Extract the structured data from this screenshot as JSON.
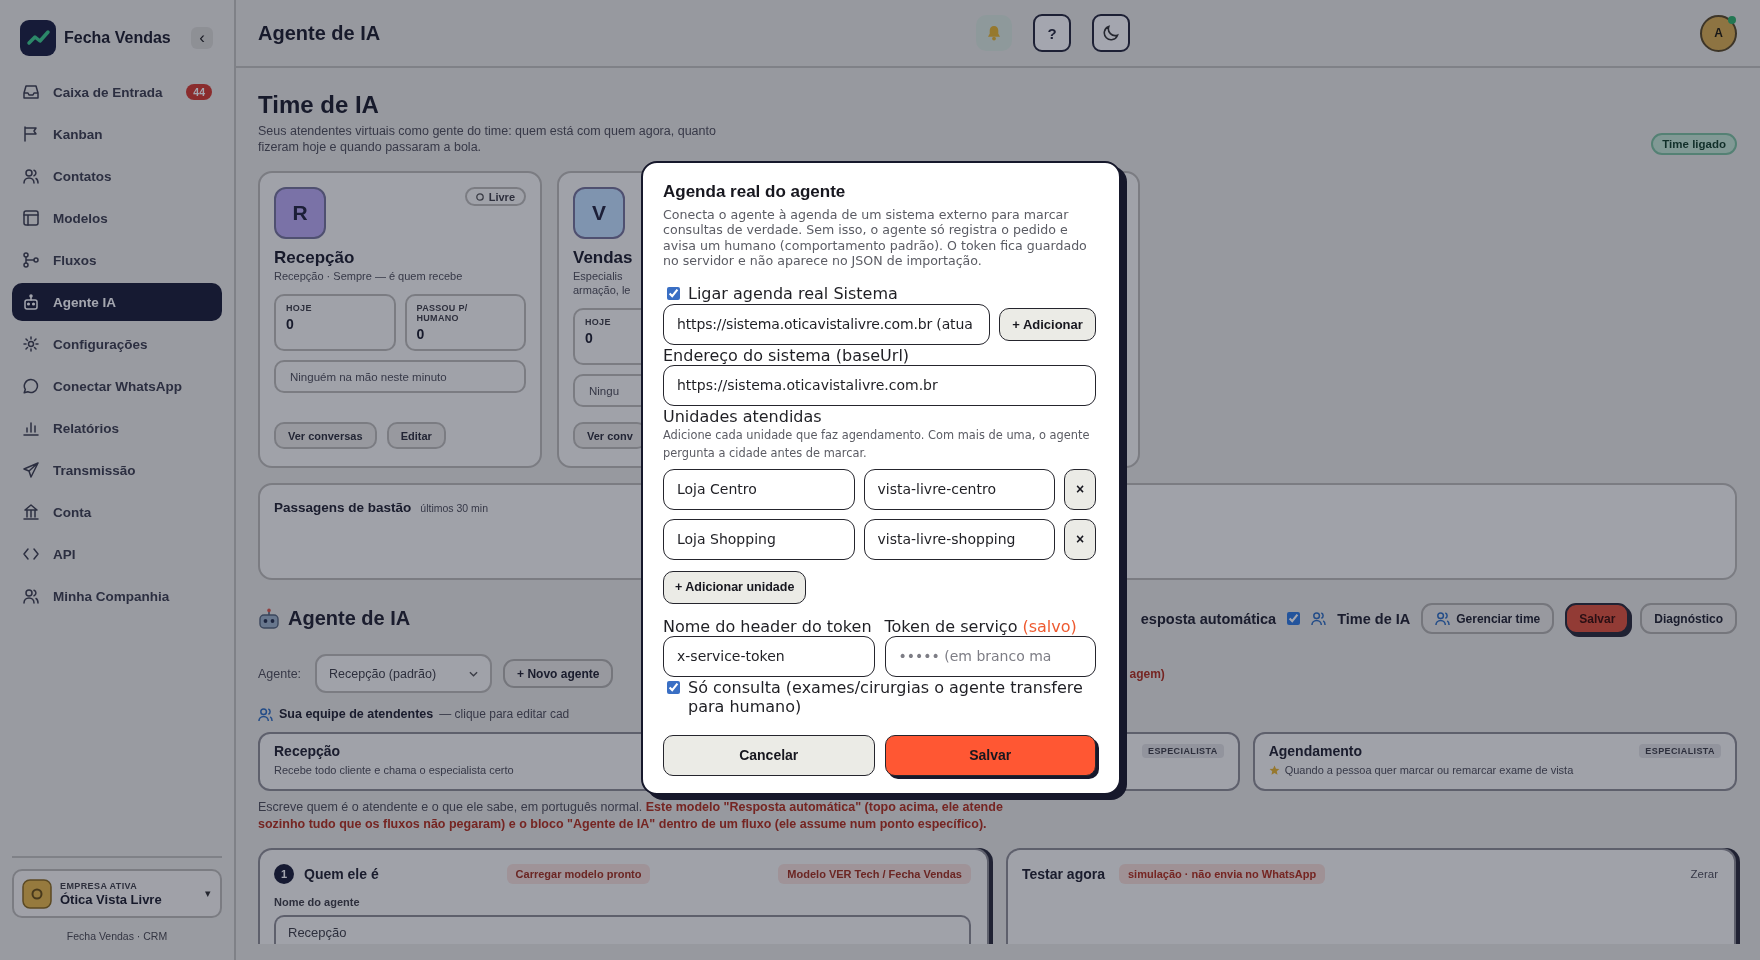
{
  "sidebar": {
    "brand": "Fecha Vendas",
    "collapse": "‹",
    "items": [
      {
        "label": "Caixa de Entrada",
        "selected": false,
        "badge": "44"
      },
      {
        "label": "Kanban",
        "selected": false
      },
      {
        "label": "Contatos",
        "selected": false
      },
      {
        "label": "Modelos",
        "selected": false
      },
      {
        "label": "Fluxos",
        "selected": false
      },
      {
        "label": "Agente IA",
        "selected": true
      },
      {
        "label": "Configurações",
        "selected": false
      },
      {
        "label": "Conectar WhatsApp",
        "selected": false
      },
      {
        "label": "Relatórios",
        "selected": false
      },
      {
        "label": "Transmissão",
        "selected": false
      },
      {
        "label": "Conta",
        "selected": false
      },
      {
        "label": "API",
        "selected": false
      },
      {
        "label": "Minha Companhia",
        "selected": false
      }
    ],
    "company": {
      "caption": "EMPRESA ATIVA",
      "name": "Ótica Vista Livre",
      "caret": "▾"
    },
    "footer": "Fecha Vendas · CRM"
  },
  "header": {
    "title": "Agente de IA",
    "help": "?",
    "avatar": "A",
    "online": true
  },
  "team": {
    "title": "Time de IA",
    "subtitle": "Seus atendentes virtuais como gente do time: quem está com quem agora, quanto fizeram hoje e quando passaram a bola.",
    "status": "Time ligado",
    "agents": [
      {
        "kind": "agent",
        "initial": "R",
        "color": "#7a72a8",
        "status": "Livre",
        "name": "Recepção",
        "role": [
          "Recepção · Sempre — é quem recebe"
        ],
        "stats": [
          {
            "label": "HOJE",
            "value": "0"
          },
          {
            "label": "PASSOU P/ HUMANO",
            "value": "0"
          }
        ],
        "current": "Ninguém na mão neste minuto",
        "actions": [
          "Ver conversas",
          "Editar"
        ]
      },
      {
        "kind": "agent",
        "initial": "V",
        "color": "#7f94af",
        "name": "Vendas",
        "role": [
          "Especialis",
          "armação, le"
        ],
        "stats": [
          {
            "label": "HOJE",
            "value": "0"
          }
        ],
        "current": "Ningu",
        "actions": [
          "Ver conv"
        ]
      },
      {
        "kind": "covered"
      }
    ]
  },
  "handoffs": {
    "title": "Passagens de bastão",
    "hint": "últimos 30 min"
  },
  "agent_config": {
    "title": "Agente de IA",
    "auto_reply": "esposta automática",
    "team_mode": {
      "label": "Time de IA",
      "checked": true
    },
    "buttons": [
      {
        "label": "Gerenciar time",
        "kind": "team"
      },
      {
        "label": "Salvar",
        "kind": "primary"
      },
      {
        "label": "Diagnóstico",
        "kind": "plain"
      }
    ],
    "agent_label": "Agente:",
    "agent_select": "Recepção (padrão)",
    "new_agent": "+ Novo agente",
    "warning": "agem)",
    "team_caption": {
      "title": "Sua equipe de atendentes",
      "hint": "— clique para editar cad"
    },
    "team_cards": [
      {
        "name": "Recepção",
        "desc": "Recebe todo cliente e chama o especialista certo",
        "starred": false
      },
      {
        "badge": "ESPECIALISTA"
      },
      {
        "name": "Agendamento",
        "badge": "ESPECIALISTA",
        "desc": "Quando a pessoa quer marcar ou remarcar exame de vista",
        "starred": true
      }
    ],
    "intro": "Escreve quem é o atendente e o que ele sabe, em português normal. **Este modelo \"Resposta automática\" (topo acima, ele atende sozinho tudo que os fluxos não pegaram) e o bloco \"Agente de IA\" dentro de um fluxo (ele assume num ponto específico).**"
  },
  "editor": {
    "step": "1",
    "title": "Quem ele é",
    "pills": [
      "Carregar modelo pronto",
      "Modelo VER Tech / Fecha Vendas"
    ],
    "name_label": "Nome do agente",
    "name_value": "Recepção"
  },
  "tester": {
    "title": "Testar agora",
    "badge": "simulação · não envia no WhatsApp",
    "reset": "Zerar"
  },
  "dialog": {
    "title": "Agenda real do agente",
    "description": "Conecta o agente à agenda de um sistema externo para marcar consultas de verdade. Sem isso, o agente só registra o pedido e avisa um humano (comportamento padrão). O token fica guardado no servidor e não aparece no JSON de importação.",
    "enable": {
      "label": "Ligar agenda real Sistema",
      "checked": true
    },
    "system_select": "https://sistema.oticavistalivre.com.br (atua",
    "add_button": "+ Adicionar",
    "base_url": {
      "label": "Endereço do sistema (baseUrl)",
      "value": "https://sistema.oticavistalivre.com.br"
    },
    "units": {
      "label": "Unidades atendidas",
      "help": "Adicione cada unidade que faz agendamento. Com mais de uma, o agente pergunta a cidade antes de marcar.",
      "rows": [
        {
          "name": "Loja Centro",
          "code": "vista-livre-centro",
          "remove": "×"
        },
        {
          "name": "Loja Shopping",
          "code": "vista-livre-shopping",
          "remove": "×"
        }
      ],
      "add_button": "+ Adicionar unidade"
    },
    "token_header": {
      "label": "Nome do header do token",
      "value": "x-service-token"
    },
    "token": {
      "label": "Token de serviço",
      "status": "(salvo)",
      "placeholder": "••••• (em branco ma"
    },
    "consult_only": {
      "label": "Só consulta (exames/cirurgias o agente transfere para humano)",
      "checked": true
    },
    "buttons": [
      {
        "label": "Cancelar",
        "kind": "secondary"
      },
      {
        "label": "Salvar",
        "kind": "primary"
      }
    ]
  }
}
